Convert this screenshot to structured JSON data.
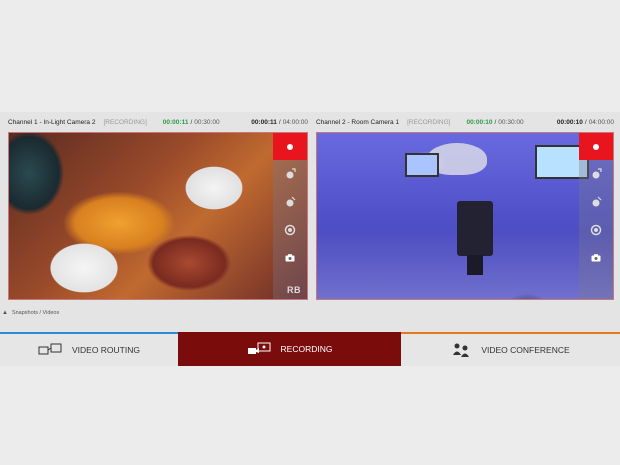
{
  "channels": [
    {
      "title": "Channel 1 - In-Light Camera 2",
      "status": "[RECORDING]",
      "rec_elapsed": "00:00:11",
      "rec_limit": "00:30:00",
      "clip_elapsed": "00:00:11",
      "clip_total": "04:00:00",
      "watermark": "RB"
    },
    {
      "title": "Channel 2 - Room Camera 1",
      "status": "[RECORDING]",
      "rec_elapsed": "00:00:10",
      "rec_limit": "00:30:00",
      "clip_elapsed": "00:00:10",
      "clip_total": "04:00:00"
    }
  ],
  "separator": "/",
  "snapshots": {
    "label": "Snapshots / Videos",
    "icon": "triangle-icon"
  },
  "tabs": [
    {
      "label": "VIDEO ROUTING",
      "icon": "video-routing-icon"
    },
    {
      "label": "RECORDING",
      "icon": "recording-icon",
      "active": true
    },
    {
      "label": "VIDEO CONFERENCE",
      "icon": "conference-icon"
    }
  ],
  "colors": {
    "record_red": "#e8141e",
    "active_tab": "#7a0c0c",
    "timer_green": "#2e9a4a",
    "routing_accent": "#2b8bd6",
    "conference_accent": "#e07a1a"
  }
}
